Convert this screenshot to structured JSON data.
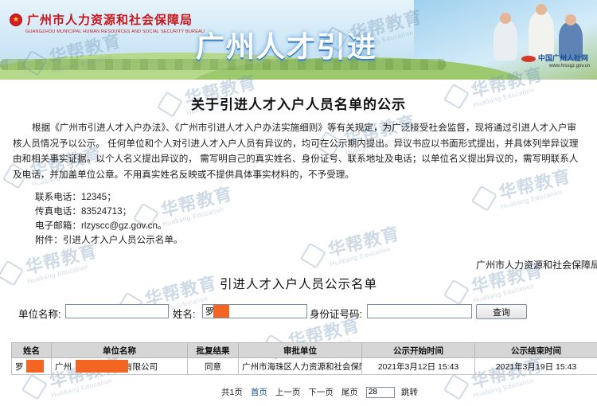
{
  "banner": {
    "org_cn": "广州市人力资源和社会保障局",
    "org_en": "GUANGZHOU MUNICIPAL HUMAN RESOURCES AND SOCIAL SECURITY BUREAU",
    "title": "广州人才引进",
    "site_name": "中国广州人社网",
    "site_url": "www.hrssgz.gov.cn"
  },
  "watermark": {
    "text_cn": "华帮教育",
    "text_en": "Huabang Education"
  },
  "notice": {
    "title": "关于引进人才入户人员名单的公示",
    "lines": [
      "根据《广州市引进人才入户办法》、《广州市引进人才入户办法实施细则》等有关规定，为广泛接受社会监督，现将通过引进人才入户审",
      "核人员情况予以公示。 任何单位和个人对引进人才入户人员有异议的，均可在公示期内提出。异议书应以书面形式提出，并具体列举异议理",
      "由和相关事实证据。以个人名义提出异议的， 需写明自己的真实姓名、身份证号、联系地址及电话；以单位名义提出异议的，需写明联系人",
      "及电话，并加盖单位公章。不用真实姓名反映或不提供具体事实材料的，不予受理。"
    ],
    "contact": {
      "phone": "联系电话：12345；",
      "fax": "传真电话：83524713；",
      "email": "电子邮箱：rlzyscc@gz.gov.cn。",
      "attachment": "附件：引进人才入户人员公示名单。"
    },
    "issuer": "广州市人力资源和社会保障局"
  },
  "list": {
    "title": "引进人才入户人员公示名单",
    "search": {
      "unit_label": "单位名称:",
      "unit_value": "",
      "name_label": "姓名:",
      "name_value": "罗",
      "id_label": "身份证号码:",
      "id_value": "",
      "button": "查询"
    },
    "columns": [
      "姓名",
      "单位名称",
      "批复结果",
      "审批单位",
      "公示开始时间",
      "公示结束时间"
    ],
    "rows": [
      {
        "name": "罗",
        "unit_prefix": "广州",
        "unit_suffix": "有限公司",
        "result": "同意",
        "approver": "广州市海珠区人力资源和社会保障局",
        "start": "2021年3月12日 15:43",
        "end": "2021年3月19日 15:43"
      }
    ]
  },
  "pager": {
    "total": "共1页",
    "first": "首页",
    "prev": "上一页",
    "next": "下一页",
    "last": "尾页",
    "jump_value": "28",
    "jump": "跳转"
  },
  "colors": {
    "org_red": "#c8151b",
    "redaction": "#f26522",
    "table_header": "#d6d6d6",
    "link_blue": "#1a4fa0"
  }
}
